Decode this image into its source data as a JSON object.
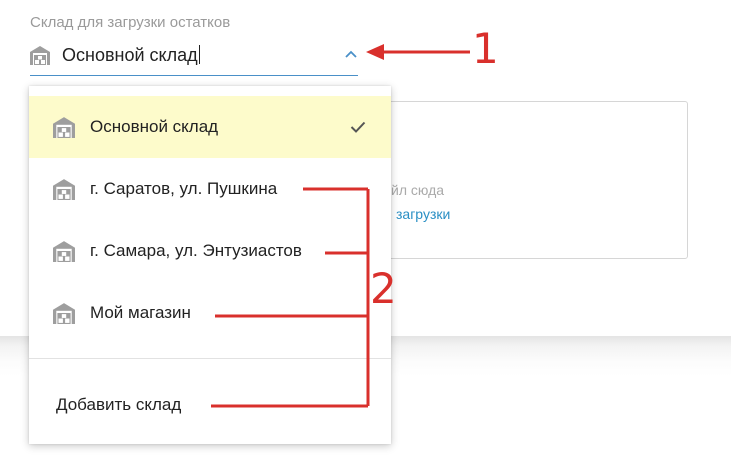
{
  "field": {
    "label": "Склад для загрузки остатков",
    "value": "Основной склад",
    "icon": "warehouse-icon",
    "toggle_icon": "chevron-up-icon"
  },
  "dropdown": {
    "options": [
      {
        "label": "Основной склад",
        "selected": true
      },
      {
        "label": "г. Саратов, ул. Пушкина",
        "selected": false
      },
      {
        "label": "г. Самара, ул. Энтузиастов",
        "selected": false
      },
      {
        "label": "Мой магазин",
        "selected": false
      }
    ],
    "add_label": "Добавить склад"
  },
  "upload": {
    "hint_text": "йл сюда",
    "link_text": "загрузки"
  },
  "annotations": {
    "one": "1",
    "two": "2"
  },
  "colors": {
    "accent": "#4a90c8",
    "link": "#2a8fc4",
    "selected_bg": "#fdfbcb",
    "icon_gray": "#9e9e9e",
    "annotation_red": "#d9302c"
  }
}
